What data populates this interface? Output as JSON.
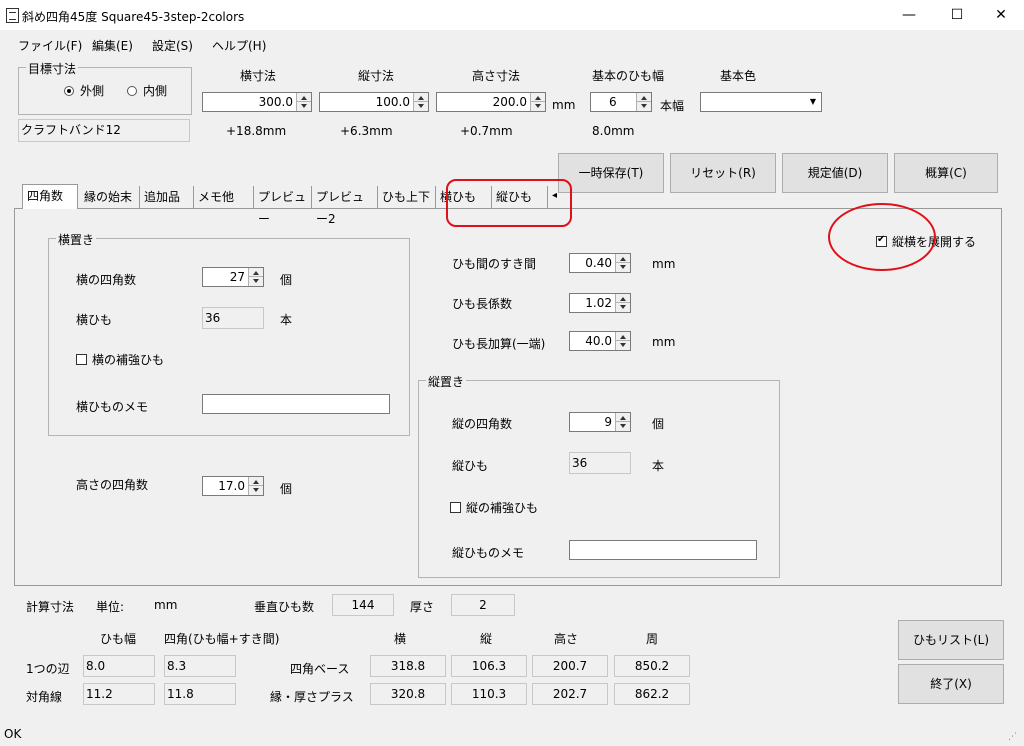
{
  "window": {
    "title": "斜め四角45度 Square45-3step-2colors",
    "minimize": "—",
    "maximize": "☐",
    "close": "✕"
  },
  "menu": [
    "ファイル(F)",
    "編集(E)",
    "設定(S)",
    "ヘルプ(H)"
  ],
  "target": {
    "group_title": "目標寸法",
    "outer": "外側",
    "inner": "内側",
    "selected": "外側"
  },
  "band_name": "クラフトバンド12",
  "dims": {
    "width_label": "横寸法",
    "width_value": "300.0",
    "width_diff": "+18.8mm",
    "depth_label": "縦寸法",
    "depth_value": "100.0",
    "depth_diff": "+6.3mm",
    "height_label": "高さ寸法",
    "height_value": "200.0",
    "height_diff": "+0.7mm",
    "unit": "mm",
    "band_width_label": "基本のひも幅",
    "band_width_value": "6",
    "band_width_unit": "本幅",
    "band_width_mm": "8.0mm",
    "color_label": "基本色",
    "color_value": ""
  },
  "top_buttons": [
    "一時保存(T)",
    "リセット(R)",
    "規定値(D)",
    "概算(C)"
  ],
  "tabs": [
    "四角数",
    "縁の始末",
    "追加品",
    "メモ他",
    "プレビュー",
    "プレビュー2",
    "ひも上下",
    "横ひも",
    "縦ひも"
  ],
  "panel": {
    "expand_label": "縦横を展開する",
    "expand_checked": true,
    "horizontal": {
      "title": "横置き",
      "count_label": "横の四角数",
      "count_value": "27",
      "count_unit": "個",
      "band_label": "横ひも",
      "band_value": "36",
      "band_unit": "本",
      "reinforce_label": "横の補強ひも",
      "memo_label": "横ひものメモ",
      "memo_value": ""
    },
    "gap_label": "ひも間のすき間",
    "gap_value": "0.40",
    "gap_unit": "mm",
    "coef_label": "ひも長係数",
    "coef_value": "1.02",
    "add_label": "ひも長加算(一端)",
    "add_value": "40.0",
    "add_unit": "mm",
    "vertical": {
      "title": "縦置き",
      "count_label": "縦の四角数",
      "count_value": "9",
      "count_unit": "個",
      "band_label": "縦ひも",
      "band_value": "36",
      "band_unit": "本",
      "reinforce_label": "縦の補強ひも",
      "memo_label": "縦ひものメモ",
      "memo_value": ""
    },
    "height_count_label": "高さの四角数",
    "height_count_value": "17.0",
    "height_count_unit": "個"
  },
  "calc": {
    "title": "計算寸法",
    "unit_label": "単位:",
    "unit_value": "mm",
    "vertical_bands_label": "垂直ひも数",
    "vertical_bands_value": "144",
    "thickness_label": "厚さ",
    "thickness_value": "2",
    "col_band_width": "ひも幅",
    "col_square": "四角(ひも幅+すき間)",
    "col_w": "横",
    "col_d": "縦",
    "col_h": "高さ",
    "col_p": "周",
    "row1_label": "1つの辺",
    "row1_band": "8.0",
    "row1_square": "8.3",
    "row2_label": "対角線",
    "row2_band": "11.2",
    "row2_square": "11.8",
    "base_label": "四角ベース",
    "base_w": "318.8",
    "base_d": "106.3",
    "base_h": "200.7",
    "base_p": "850.2",
    "edge_label": "縁・厚さプラス",
    "edge_w": "320.8",
    "edge_d": "110.3",
    "edge_h": "202.7",
    "edge_p": "862.2"
  },
  "bottom_buttons": {
    "band_list": "ひもリスト(L)",
    "exit": "終了(X)"
  },
  "status": "OK",
  "colors": {
    "annotation": "#e0101a"
  }
}
